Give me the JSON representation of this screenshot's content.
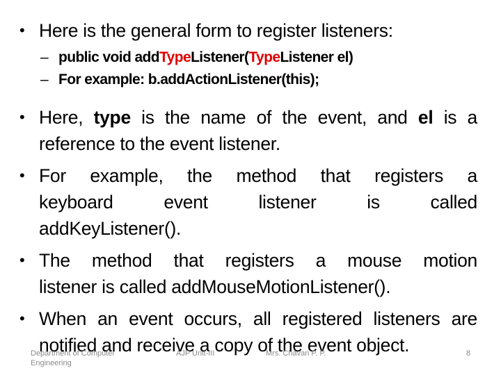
{
  "slide": {
    "title": "",
    "bullets": [
      {
        "text": "Here is the general form to register listeners:",
        "subitems": [
          {
            "dash": "–",
            "parts": [
              {
                "text": "public void add",
                "color": "black"
              },
              {
                "text": "Type",
                "color": "red"
              },
              {
                "text": "Listener(",
                "color": "black"
              },
              {
                "text": "Type",
                "color": "red"
              },
              {
                "text": "Listener el)",
                "color": "black"
              }
            ]
          },
          {
            "dash": "–",
            "text": "For example: b.addActionListener(this);"
          }
        ]
      },
      {
        "lines": [
          {
            "parts": [
              "Here, ",
              "type",
              " is the name of the event, and ",
              "el",
              " is a"
            ]
          },
          {
            "text": "reference to the event listener."
          }
        ]
      },
      {
        "lines": [
          {
            "text": "For example, the method that registers a"
          },
          {
            "text": "keyboard event listener is called"
          },
          {
            "text": "addKeyListener()."
          }
        ]
      },
      {
        "lines": [
          {
            "text": "The method that registers a mouse motion"
          },
          {
            "text": "listener is called addMouseMotionListener()."
          }
        ]
      },
      {
        "lines": [
          {
            "text": "When an event occurs, all registered listeners are"
          },
          {
            "text": "notified and receive a copy of the event object."
          }
        ]
      }
    ],
    "bullet_glyph": "•"
  },
  "footer": {
    "department_line1": "Department of Computer",
    "department_line2": "Engineering",
    "course": "AJP Unit-III",
    "author": "Mrs. Chavan P. P.",
    "page_number": "8"
  },
  "colors": {
    "text": "#000000",
    "highlight": "#e00000",
    "footer": "#8a8a8a"
  }
}
